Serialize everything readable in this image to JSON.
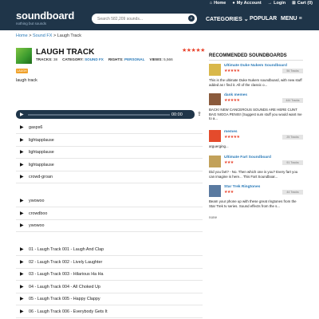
{
  "topbar": {
    "home": "Home",
    "account": "My Account",
    "login": "Login",
    "cart": "Cart (0)"
  },
  "brand": {
    "logo": "soundboard",
    "tagline": "nothing but sounds"
  },
  "search": {
    "placeholder": "Search 582,209 sounds..."
  },
  "nav": {
    "categories": "CATEGORIES",
    "popular": "POPULAR",
    "menu": "MENU"
  },
  "breadcrumb": {
    "home": "Home",
    "sfx": "Sound FX",
    "sep": ">",
    "current": "Laugh Track"
  },
  "board": {
    "title": "LAUGH TRACK",
    "rating": "★★★★★",
    "tracks_label": "TRACKS:",
    "tracks": "38",
    "category_label": "CATEGORY:",
    "category": "SOUND FX",
    "rights_label": "RIGHTS:",
    "rights": "PERSONAL",
    "views_label": "VIEWS:",
    "views": "5,566",
    "badge": "LAUGH",
    "description": "laugh track"
  },
  "player": {
    "time": "00:00"
  },
  "tracks": [
    "gasps6",
    "lightapplause",
    "lightapplause",
    "lightapplause",
    "crowd-groan",
    "ywowoo",
    "crowdboo",
    "ywowoo",
    "01 - Laugh Track 001 - Laugh And Clap",
    "02 - Laugh Track 002 - Lively Laughter",
    "03 - Laugh Track 003 - Hilarious Ha Ha",
    "04 - Laugh Track 004 - All Choked Up",
    "05 - Laugh Track 005 - Happy Clappy",
    "06 - Laugh Track 006 - Everybody Gets It"
  ],
  "sidebar": {
    "title": "RECOMMENDED SOUNDBOARDS",
    "items": [
      {
        "name": "Ultimate Duke Nukem Soundboard",
        "stars": "★★★★★",
        "tracks": "56 Tracks",
        "desc": "This is the ultimate Duke Nukem soundboard, with new stuff added as I find it. All of the classic o...",
        "color": "#d9b84a"
      },
      {
        "name": "dank memes",
        "stars": "★★★★★",
        "tracks": "444 Tracks",
        "desc": "BACK! NEW CANCEROUS SOUNDS ARE HERE CUNT BAG NIGGA PENIS! (Suggest sum stuff you would want me to a...",
        "color": "#8a5a3c"
      },
      {
        "name": "memes",
        "stars": "★★★★★",
        "tracks": "25 Tracks",
        "desc": "arguerging...",
        "color": "#e44b2c"
      },
      {
        "name": "Ultimate Fart Soundboard",
        "stars": "★★★",
        "tracks": "91 Tracks",
        "desc": "Did you fart? - No. Then which one is you? Every fart you can imagine is here... This Fart Soundboar...",
        "color": "#c2a15a"
      },
      {
        "name": "Star Trek Ringtones",
        "stars": "★★★",
        "tracks": "44 Tracks",
        "desc": "Beam your phone up with these great ringtones from the Star Trek tv series. Sound effects from the s...",
        "color": "#5a7aa0"
      }
    ],
    "more": "none"
  }
}
